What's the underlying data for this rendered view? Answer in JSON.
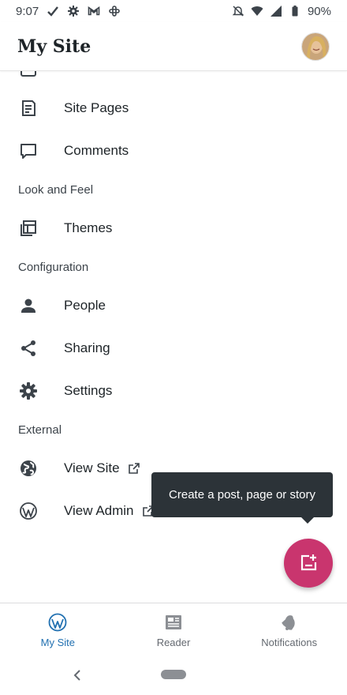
{
  "status_bar": {
    "time": "9:07",
    "battery": "90%"
  },
  "app_bar": {
    "title": "My Site"
  },
  "menu": {
    "items_top": [
      {
        "label": "Site Pages",
        "icon": "pages-icon"
      },
      {
        "label": "Comments",
        "icon": "comment-icon"
      }
    ],
    "section_look": "Look and Feel",
    "items_look": [
      {
        "label": "Themes",
        "icon": "themes-icon"
      }
    ],
    "section_config": "Configuration",
    "items_config": [
      {
        "label": "People",
        "icon": "person-icon"
      },
      {
        "label": "Sharing",
        "icon": "share-icon"
      },
      {
        "label": "Settings",
        "icon": "gear-icon"
      }
    ],
    "section_external": "External",
    "items_external": [
      {
        "label": "View Site",
        "icon": "globe-icon"
      },
      {
        "label": "View Admin",
        "icon": "wordpress-icon"
      }
    ]
  },
  "tooltip": {
    "text": "Create a post, page or story"
  },
  "bottom_nav": {
    "items": [
      {
        "label": "My Site",
        "active": true
      },
      {
        "label": "Reader",
        "active": false
      },
      {
        "label": "Notifications",
        "active": false
      }
    ]
  },
  "colors": {
    "accent": "#2271b1",
    "fab": "#c9356e",
    "tooltip_bg": "#2c3338",
    "icon": "#3c434a"
  }
}
